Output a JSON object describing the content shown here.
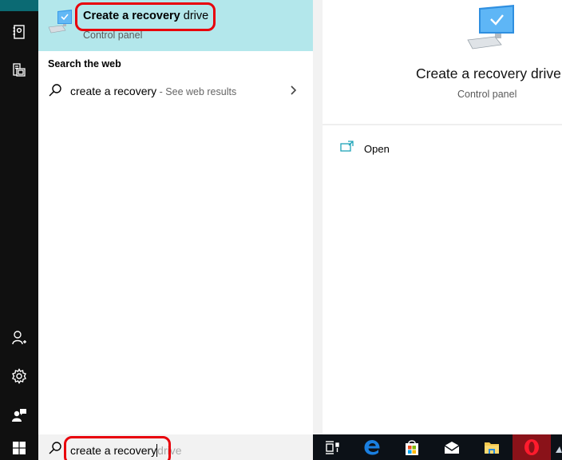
{
  "rail": {
    "icons": [
      {
        "name": "notebook-icon"
      },
      {
        "name": "documents-icon"
      },
      {
        "name": "add-user-icon"
      },
      {
        "name": "settings-icon"
      },
      {
        "name": "feedback-icon"
      }
    ]
  },
  "best_match": {
    "title_typed": "Create a recovery",
    "title_rest": " drive",
    "subtitle": "Control panel",
    "icon": "computer-check-icon"
  },
  "web_section": {
    "heading": "Search the web",
    "query": "create a recovery",
    "hint": " - See web results"
  },
  "preview": {
    "title": "Create a recovery drive",
    "subtitle": "Control panel",
    "actions": [
      {
        "label": "Open",
        "icon": "open-icon"
      }
    ]
  },
  "search_box": {
    "typed": "create a recovery",
    "suggestion": "drive"
  },
  "taskbar": {
    "items": [
      {
        "name": "task-view"
      },
      {
        "name": "edge"
      },
      {
        "name": "store"
      },
      {
        "name": "mail"
      },
      {
        "name": "file-explorer"
      },
      {
        "name": "opera"
      }
    ]
  },
  "colors": {
    "highlight": "#b3e7eb",
    "annotation": "#e8000b",
    "accent": "#0b6a73",
    "opera_active": "#8a1219"
  }
}
